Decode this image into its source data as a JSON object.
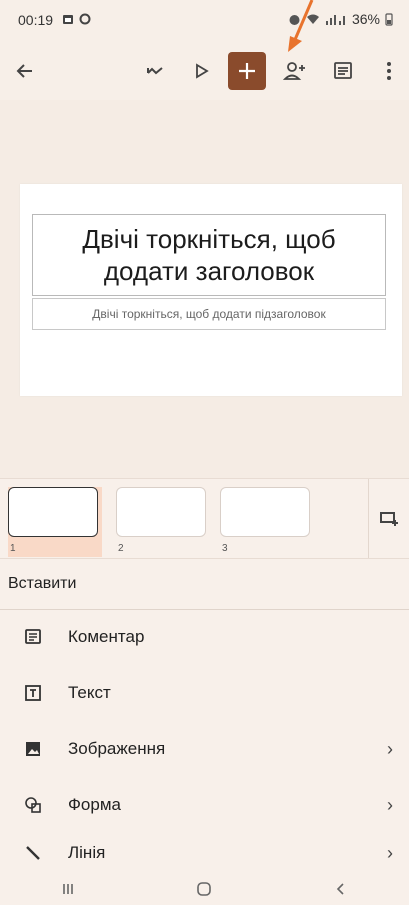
{
  "status_bar": {
    "time": "00:19",
    "battery": "36%"
  },
  "toolbar": {
    "back": "arrow-left-icon",
    "undo": "undo-icon",
    "play": "play-icon",
    "add": "plus-icon",
    "share": "add-person-icon",
    "comments": "comment-icon",
    "more": "more-vert-icon",
    "accent_color": "#8a4b2c"
  },
  "slide": {
    "title_placeholder": "Двічі торкніться, щоб додати заголовок",
    "subtitle_placeholder": "Двічі торкніться, щоб додати підзаголовок"
  },
  "filmstrip": {
    "slides": [
      {
        "number": "1",
        "selected": true
      },
      {
        "number": "2",
        "selected": false
      },
      {
        "number": "3",
        "selected": false
      }
    ]
  },
  "insert_panel": {
    "header": "Вставити",
    "items": [
      {
        "label": "Коментар",
        "icon": "comment-icon",
        "has_submenu": false,
        "chevron": ""
      },
      {
        "label": "Текст",
        "icon": "text-box-icon",
        "has_submenu": false,
        "chevron": ""
      },
      {
        "label": "Зображення",
        "icon": "image-icon",
        "has_submenu": true,
        "chevron": "›"
      },
      {
        "label": "Форма",
        "icon": "shape-icon",
        "has_submenu": true,
        "chevron": "›"
      },
      {
        "label": "Лінія",
        "icon": "line-icon",
        "has_submenu": true,
        "chevron": "›"
      }
    ]
  },
  "nav_bar": {
    "recents": "recents-icon",
    "home": "home-icon",
    "back": "back-icon"
  }
}
